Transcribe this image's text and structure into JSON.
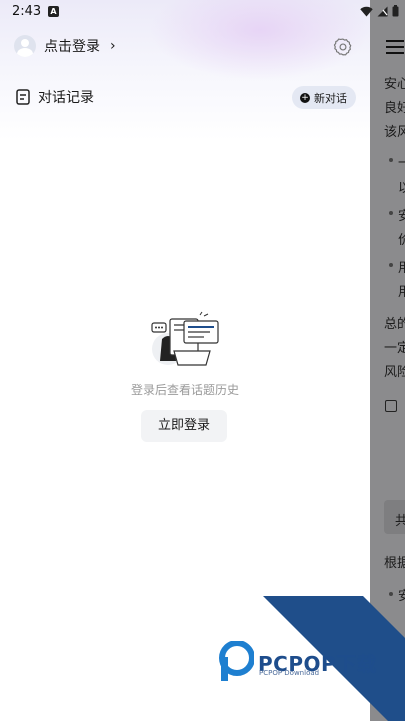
{
  "status_bar": {
    "time": "2:43",
    "a_icon_label": "A"
  },
  "drawer": {
    "login_text": "点击登录",
    "login_chevron": "›",
    "history_title": "对话记录",
    "new_chat_label": "新对话",
    "empty_message": "登录后查看话题历史",
    "login_button": "立即登录"
  },
  "background_page": {
    "lines": [
      "安心",
      "良好",
      "该风",
      "一",
      "以",
      "安",
      "价",
      "用",
      "用",
      "总的",
      "一定",
      "风险",
      "共",
      "根据",
      "安"
    ]
  },
  "watermark": {
    "brand": "PCPOP下载",
    "sub": "PCPOP Download"
  },
  "colors": {
    "accent": "#1e4d8c",
    "pill_bg": "#e4e8f3"
  }
}
